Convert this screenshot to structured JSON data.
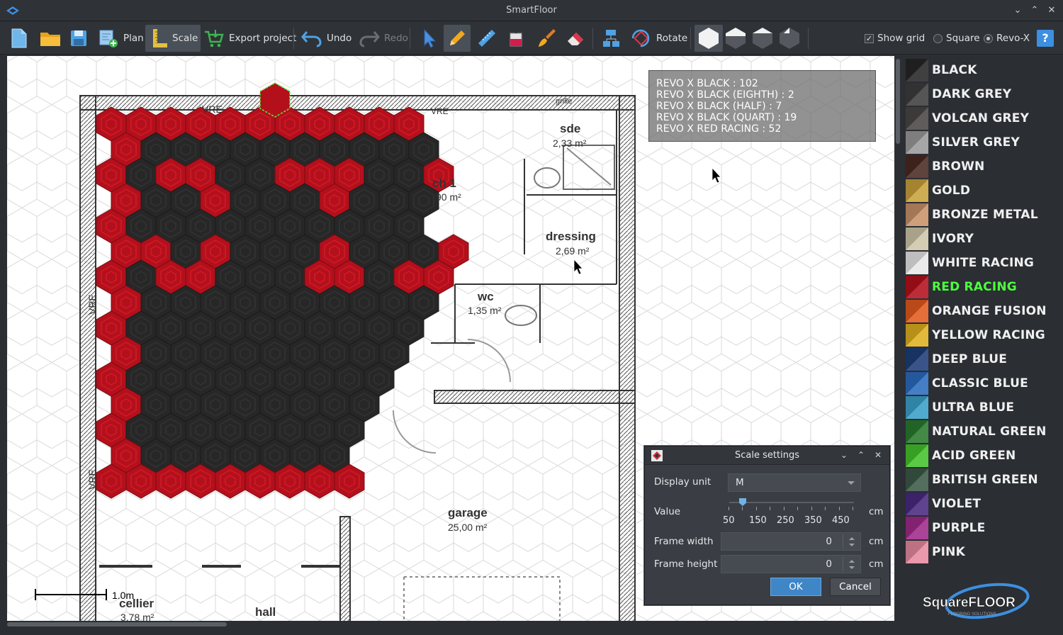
{
  "window": {
    "title": "SmartFloor"
  },
  "toolbar": {
    "plan": "Plan",
    "scale": "Scale",
    "export": "Export project",
    "undo": "Undo",
    "redo": "Redo",
    "rotate": "Rotate",
    "show_grid": "Show grid",
    "square": "Square",
    "revo": "Revo-X",
    "help": "?"
  },
  "legend": {
    "lines": [
      "REVO X BLACK : 102",
      "REVO X BLACK (EIGHTH) : 2",
      "REVO X BLACK (HALF) : 7",
      "REVO X BLACK (QUART) : 19",
      "REVO X RED RACING : 52"
    ]
  },
  "plan": {
    "rooms": [
      {
        "name": "sde",
        "area": "2,33 m²"
      },
      {
        "name": "ch 1",
        "area": "90 m²"
      },
      {
        "name": "dressing",
        "area": "2,69 m²"
      },
      {
        "name": "wc",
        "area": "1,35 m²"
      },
      {
        "name": "garage",
        "area": "25,00 m²"
      },
      {
        "name": "cellier",
        "area": "3,78 m²"
      },
      {
        "name": "hall",
        "area": ""
      }
    ],
    "labels": {
      "vre1": "VRE",
      "vre2": "VRE",
      "vre3": "VRE",
      "vre4": "VRE",
      "grille": "grille"
    },
    "scale_label": "1.0m"
  },
  "palette": [
    {
      "name": "BLACK",
      "color": "#262626",
      "selected": false
    },
    {
      "name": "DARK GREY",
      "color": "#3e3e3e",
      "selected": false
    },
    {
      "name": "VOLCAN GREY",
      "color": "#4a4646",
      "selected": false
    },
    {
      "name": "SILVER GREY",
      "color": "#9a9a9a",
      "selected": false
    },
    {
      "name": "BROWN",
      "color": "#4a2a22",
      "selected": false
    },
    {
      "name": "GOLD",
      "color": "#c9a23c",
      "selected": false
    },
    {
      "name": "BRONZE METAL",
      "color": "#c9926a",
      "selected": false
    },
    {
      "name": "IVORY",
      "color": "#cfc6aa",
      "selected": false
    },
    {
      "name": "WHITE RACING",
      "color": "#e8e8e8",
      "selected": false
    },
    {
      "name": "RED RACING",
      "color": "#b3101c",
      "selected": true
    },
    {
      "name": "ORANGE FUSION",
      "color": "#e25a1e",
      "selected": false
    },
    {
      "name": "YELLOW RACING",
      "color": "#e0b020",
      "selected": false
    },
    {
      "name": "DEEP BLUE",
      "color": "#1e3d78",
      "selected": false
    },
    {
      "name": "CLASSIC BLUE",
      "color": "#2c6cc0",
      "selected": false
    },
    {
      "name": "ULTRA BLUE",
      "color": "#3aa0c8",
      "selected": false
    },
    {
      "name": "NATURAL GREEN",
      "color": "#2a7a2e",
      "selected": false
    },
    {
      "name": "ACID GREEN",
      "color": "#44c22c",
      "selected": false
    },
    {
      "name": "BRITISH GREEN",
      "color": "#3c5a48",
      "selected": false
    },
    {
      "name": "VIOLET",
      "color": "#4a2a80",
      "selected": false
    },
    {
      "name": "PURPLE",
      "color": "#a02a8a",
      "selected": false
    },
    {
      "name": "PINK",
      "color": "#e88aa0",
      "selected": false
    }
  ],
  "brand": {
    "text": "SquareFLOOR"
  },
  "dialog": {
    "title": "Scale settings",
    "display_unit_label": "Display unit",
    "display_unit_value": "M",
    "value_label": "Value",
    "value_unit": "cm",
    "slider_ticks": [
      "50",
      "150",
      "250",
      "350",
      "450"
    ],
    "frame_width_label": "Frame width",
    "frame_width_value": "0",
    "frame_width_unit": "cm",
    "frame_height_label": "Frame height",
    "frame_height_value": "0",
    "frame_height_unit": "cm",
    "ok": "OK",
    "cancel": "Cancel"
  },
  "colors": {
    "accent": "#3d8fe0",
    "tile_black": "#262626",
    "tile_red": "#b3101c",
    "selected_text": "#4cff3c"
  }
}
